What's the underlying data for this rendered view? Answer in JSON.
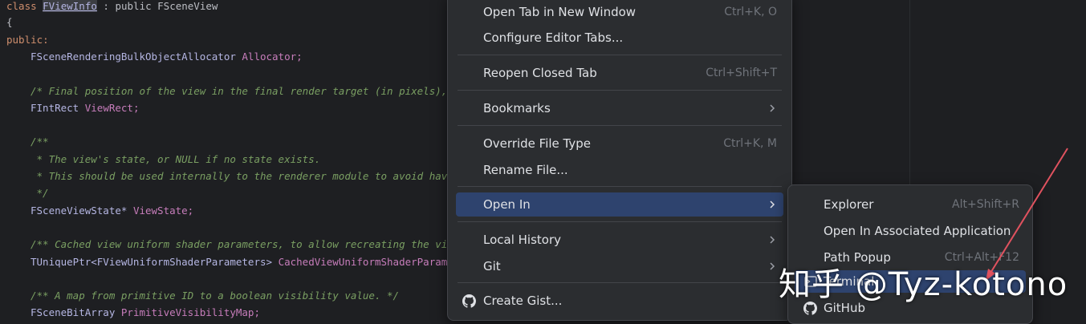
{
  "editor": {
    "lines": [
      {
        "a": "class ",
        "b": "FViewInfo",
        "c": " : public FSceneView"
      },
      {
        "t": "{"
      },
      {
        "t": "public:"
      },
      {
        "type": "FSceneRenderingBulkObjectAllocator",
        "name": "Allocator;"
      },
      {
        "comment": "/* Final position of the view in the final render target (in pixels),"
      },
      {
        "type": "FIntRect",
        "name": "ViewRect;"
      },
      {
        "comment": "/**"
      },
      {
        "comment": " * The view's state, or NULL if no state exists."
      },
      {
        "comment": " * This should be used internally to the renderer module to avoid hav"
      },
      {
        "comment": " */"
      },
      {
        "type": "FSceneViewState*",
        "name": "ViewState;"
      },
      {
        "comment": "/** Cached view uniform shader parameters, to allow recreating the vi"
      },
      {
        "type": "TUniquePtr<FViewUniformShaderParameters>",
        "name": "CachedViewUniformShaderParame"
      },
      {
        "comment": "/** A map from primitive ID to a boolean visibility value. */"
      },
      {
        "type": "FSceneBitArray",
        "name": "PrimitiveVisibilityMap;"
      }
    ]
  },
  "menu": {
    "items": [
      {
        "label": "Open Tab in New Window",
        "shortcut": "Ctrl+K, O"
      },
      {
        "label": "Configure Editor Tabs..."
      },
      {
        "label": "Reopen Closed Tab",
        "shortcut": "Ctrl+Shift+T"
      },
      {
        "label": "Bookmarks",
        "submenu": true
      },
      {
        "label": "Override File Type",
        "shortcut": "Ctrl+K, M"
      },
      {
        "label": "Rename File..."
      },
      {
        "label": "Open In",
        "submenu": true,
        "selected": true
      },
      {
        "label": "Local History",
        "submenu": true
      },
      {
        "label": "Git",
        "submenu": true
      },
      {
        "label": "Create Gist...",
        "icon": "github-icon"
      }
    ]
  },
  "submenu": {
    "items": [
      {
        "label": "Explorer",
        "shortcut": "Alt+Shift+R"
      },
      {
        "label": "Open In Associated Application"
      },
      {
        "label": "Path Popup",
        "shortcut": "Ctrl+Alt+F12"
      },
      {
        "label": "Terminal",
        "selected": true
      },
      {
        "label": "GitHub",
        "icon": "github-icon"
      }
    ]
  },
  "watermark": {
    "text": "知乎 @Tyz-kotono"
  },
  "colors": {
    "selection": "#2e436e",
    "menu_bg": "#2b2d30",
    "editor_bg": "#1e1f22",
    "annotation_arrow": "#e0525f"
  }
}
